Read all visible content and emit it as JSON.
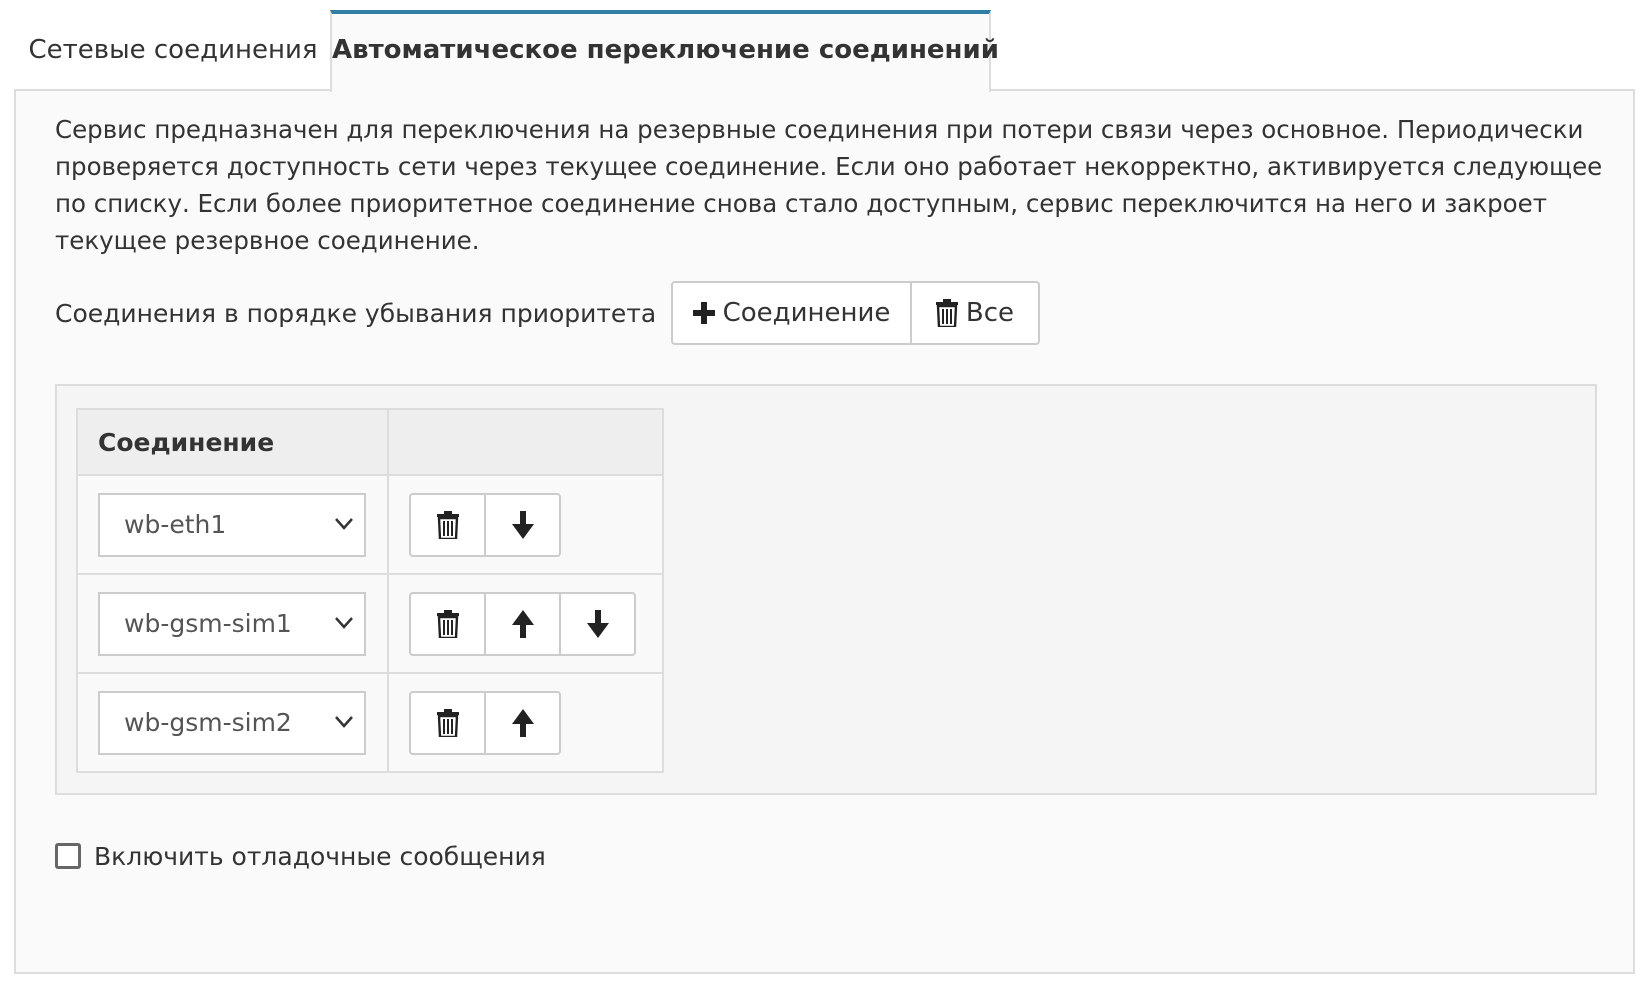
{
  "tabs": [
    {
      "label": "Сетевые соединения",
      "active": false
    },
    {
      "label": "Автоматическое переключение соединений",
      "active": true
    }
  ],
  "colors": {
    "accent": "#2f7ea5",
    "border": "#dddddd",
    "panel_bg": "#fafafa"
  },
  "description": "Сервис предназначен для переключения на резервные соединения при потери связи через основное. Периодически проверяется доступность сети через текущее соединение. Если оно работает некорректно, активируется следующее по списку. Если более приоритетное соединение снова стало доступным, сервис переключится на него и закроет текущее резервное соединение.",
  "priority": {
    "label": "Соединения в порядке убывания приоритета",
    "add_button": {
      "icon": "plus-icon",
      "label": "Соединение"
    },
    "clear_button": {
      "icon": "trash-icon",
      "label": "Все"
    }
  },
  "table": {
    "header_connection": "Соединение",
    "header_actions": "",
    "rows": [
      {
        "value": "wb-eth1",
        "actions": [
          "trash-icon",
          "arrow-down-icon"
        ]
      },
      {
        "value": "wb-gsm-sim1",
        "actions": [
          "trash-icon",
          "arrow-up-icon",
          "arrow-down-icon"
        ]
      },
      {
        "value": "wb-gsm-sim2",
        "actions": [
          "trash-icon",
          "arrow-up-icon"
        ]
      }
    ]
  },
  "debug": {
    "label": "Включить отладочные сообщения",
    "checked": false
  }
}
